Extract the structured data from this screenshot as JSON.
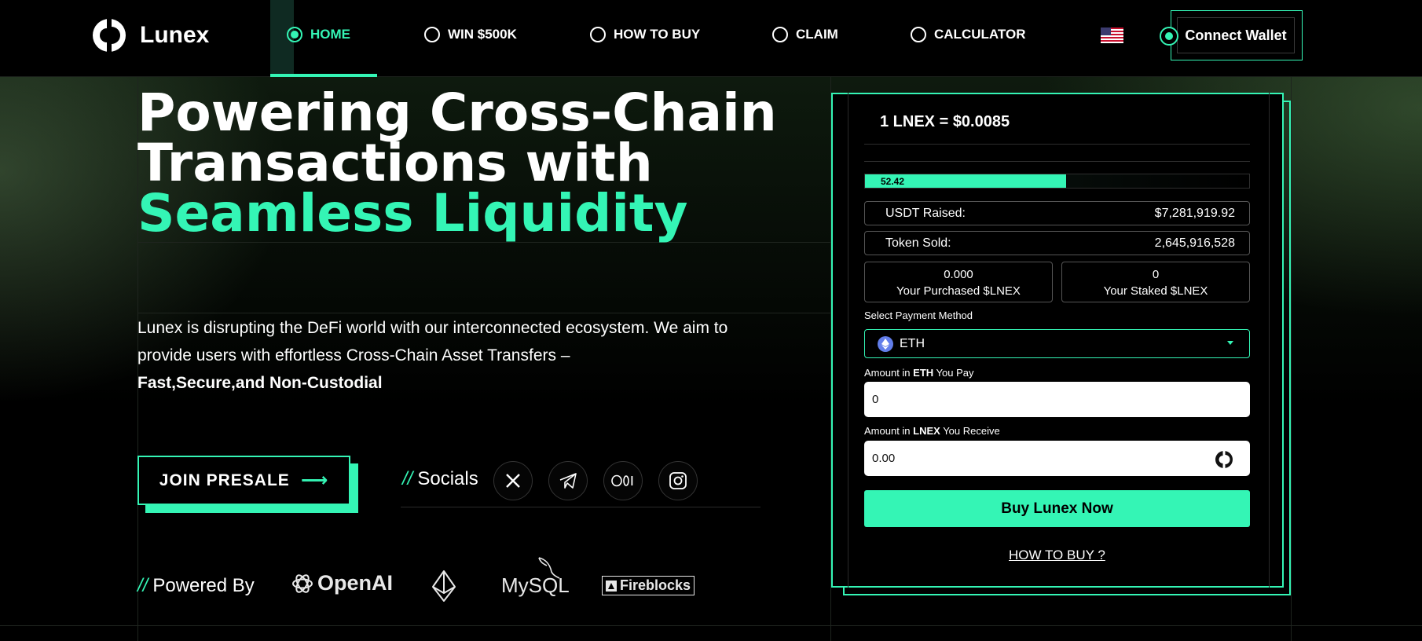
{
  "brand": {
    "name": "Lunex"
  },
  "nav": {
    "items": [
      {
        "label": "HOME",
        "active": true
      },
      {
        "label": "WIN $500K",
        "active": false
      },
      {
        "label": "HOW TO BUY",
        "active": false
      },
      {
        "label": "CLAIM",
        "active": false
      },
      {
        "label": "CALCULATOR",
        "active": false
      }
    ],
    "language_icon": "us-flag-icon",
    "connect_wallet": "Connect Wallet"
  },
  "hero": {
    "title_line1": "Powering Cross-Chain",
    "title_line2": "Transactions with",
    "title_line3": "Seamless Liquidity",
    "description": "Lunex is disrupting the DeFi world with our interconnected ecosystem. We aim to provide users with effortless Cross-Chain Asset Transfers –",
    "description_bold": "Fast,Secure,and Non-Custodial",
    "presale_button": "JOIN PRESALE",
    "socials_prefix": "//",
    "socials_label": "Socials",
    "socials": [
      "x-icon",
      "telegram-icon",
      "medium-icon",
      "instagram-icon"
    ],
    "powered_prefix": "//",
    "powered_label": "Powered By",
    "partners": [
      "OpenAI",
      "MySQL",
      "Fireblocks"
    ],
    "partner_icons": [
      "openai-logo",
      "ethereum-logo",
      "mysql-logo",
      "fireblocks-logo"
    ]
  },
  "presale": {
    "price": "1 LNEX = $0.0085",
    "progress_label": "52.42",
    "progress_percent": 52.42,
    "usdt_raised_label": "USDT Raised:",
    "usdt_raised_value": "$7,281,919.92",
    "token_sold_label": "Token Sold:",
    "token_sold_value": "2,645,916,528",
    "purchased_value": "0.000",
    "purchased_label": "Your Purchased $LNEX",
    "staked_value": "0",
    "staked_label": "Your Staked $LNEX",
    "payment_method_label": "Select Payment Method",
    "payment_method_value": "ETH",
    "pay_label_prefix": "Amount in ",
    "pay_label_token": "ETH",
    "pay_label_suffix": " You Pay",
    "pay_value": "0",
    "receive_label_prefix": "Amount in ",
    "receive_label_token": "LNEX",
    "receive_label_suffix": " You Receive",
    "receive_value": "0.00",
    "buy_button": "Buy Lunex Now",
    "how_to_buy_link": "HOW TO BUY ?"
  },
  "colors": {
    "accent": "#34f5b5",
    "background": "#000000",
    "eth": "#627eea"
  }
}
